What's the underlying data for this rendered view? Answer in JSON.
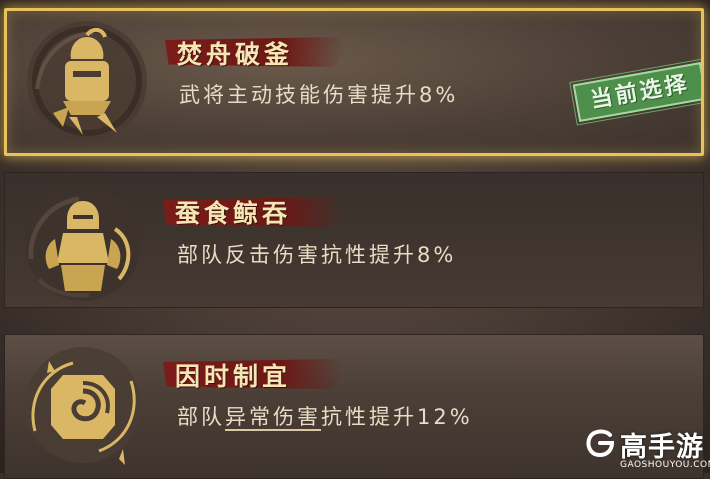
{
  "skills": [
    {
      "title": "焚舟破釜",
      "desc": "武将主动技能伤害提升8%",
      "icon": "warrior-helmet-icon",
      "selected": true
    },
    {
      "title": "蚕食鲸吞",
      "desc": "部队反击伤害抗性提升8%",
      "icon": "armored-soldier-icon",
      "selected": false
    },
    {
      "title": "因时制宜",
      "desc_prefix": "部队",
      "desc_keyword": "异常伤害",
      "desc_suffix": "抗性提升12%",
      "icon": "spiral-shield-icon",
      "selected": false
    }
  ],
  "current_badge": "当前选择",
  "watermark": {
    "name": "高手游",
    "url": "GAOSHOUYOU.COM"
  },
  "colors": {
    "selected_border": "#e7c35f",
    "title_ribbon": "#7b1c19",
    "title_text": "#f6e6b5",
    "desc_text": "#e8dcc4",
    "badge_green": "#4f8f4c",
    "emblem_gold": "#d9b765"
  }
}
